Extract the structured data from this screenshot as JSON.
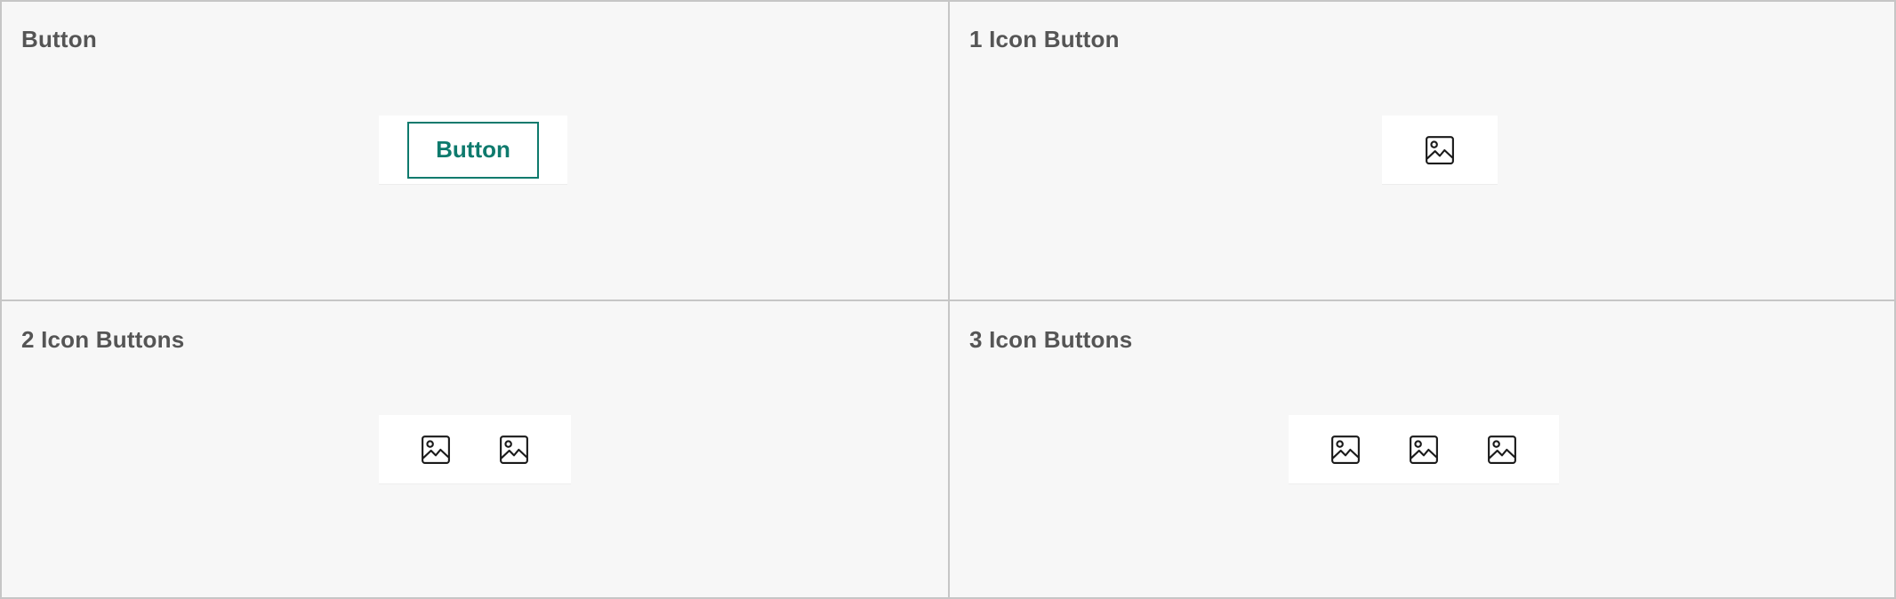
{
  "cells": [
    {
      "title": "Button",
      "button_label": "Button"
    },
    {
      "title": "1 Icon Button",
      "icons": [
        "image-icon"
      ]
    },
    {
      "title": "2 Icon Buttons",
      "icons": [
        "image-icon",
        "image-icon"
      ]
    },
    {
      "title": "3 Icon Buttons",
      "icons": [
        "image-icon",
        "image-icon",
        "image-icon"
      ]
    }
  ],
  "colors": {
    "accent": "#0e7a6d",
    "title_text": "#555555",
    "canvas": "#f7f7f7",
    "surface": "#ffffff",
    "border": "#c6c6c6"
  }
}
